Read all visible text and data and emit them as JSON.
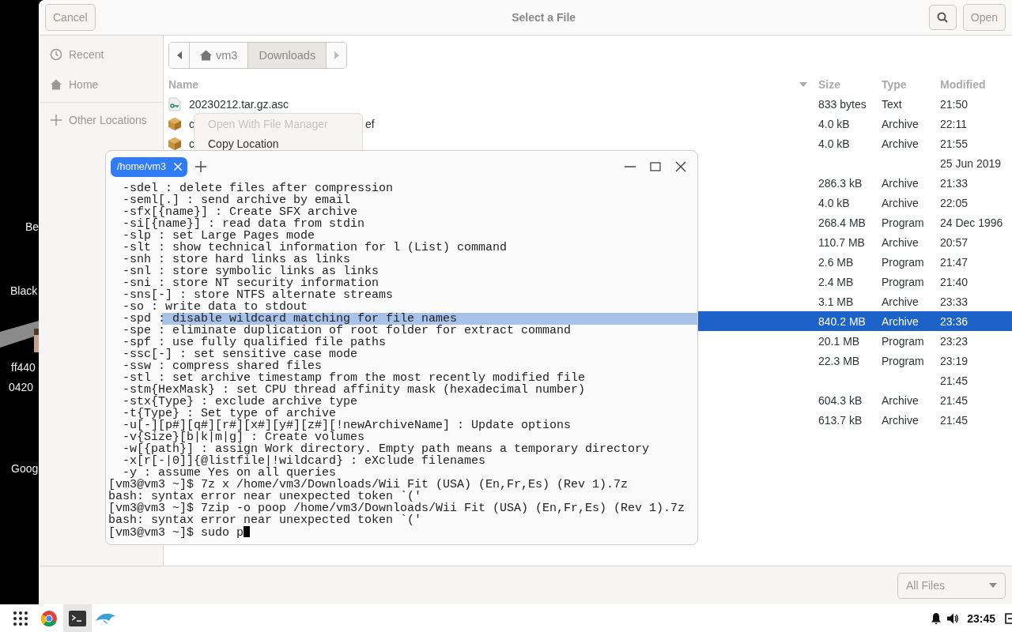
{
  "desktop": {
    "labels": [
      {
        "lines": [
          "Be"
        ]
      },
      {
        "lines": [
          "Black"
        ]
      },
      {
        "lines": [
          "ff440",
          "0420"
        ]
      },
      {
        "lines": [
          "Goog"
        ]
      }
    ]
  },
  "dialog": {
    "cancel": "Cancel",
    "title": "Select a File",
    "open": "Open",
    "sidebar": [
      {
        "kind": "recent",
        "label": "Recent"
      },
      {
        "kind": "home",
        "label": "Home"
      },
      {
        "kind": "other",
        "label": "Other Locations"
      }
    ],
    "path": [
      {
        "label": "vm3",
        "home": true,
        "selected": false
      },
      {
        "label": "Downloads",
        "home": false,
        "selected": true
      }
    ],
    "columns": [
      "Name",
      "Size",
      "Type",
      "Modified"
    ],
    "rows": [
      {
        "kind": "key",
        "name": "20230212.tar.gz.asc",
        "size": "833 bytes",
        "type": "Text",
        "modified": "21:50",
        "selected": false
      },
      {
        "kind": "archive",
        "name": "c",
        "tail": "ef",
        "size": "4.0 kB",
        "type": "Archive",
        "modified": "22:11",
        "selected": false
      },
      {
        "kind": "archive",
        "name": "c",
        "size": "4.0 kB",
        "type": "Archive",
        "modified": "21:55",
        "selected": false
      },
      {
        "modified": "25 Jun 2019",
        "selected": false
      },
      {
        "size": "286.3 kB",
        "type": "Archive",
        "modified": "21:33",
        "selected": false
      },
      {
        "size": "4.0 kB",
        "type": "Archive",
        "modified": "22:05",
        "selected": false
      },
      {
        "size": "268.4 MB",
        "type": "Program",
        "modified": "24 Dec 1996",
        "selected": false
      },
      {
        "size": "110.7 MB",
        "type": "Archive",
        "modified": "20:57",
        "selected": false
      },
      {
        "size": "2.6 MB",
        "type": "Program",
        "modified": "21:47",
        "selected": false
      },
      {
        "size": "2.4 MB",
        "type": "Program",
        "modified": "21:40",
        "selected": false
      },
      {
        "size": "3.1 MB",
        "type": "Archive",
        "modified": "23:33",
        "selected": false
      },
      {
        "size": "840.2 MB",
        "type": "Archive",
        "modified": "23:36",
        "selected": true
      },
      {
        "size": "20.1 MB",
        "type": "Program",
        "modified": "23:23",
        "selected": false
      },
      {
        "size": "22.3 MB",
        "type": "Program",
        "modified": "23:19",
        "selected": false
      },
      {
        "modified": "21:45",
        "selected": false
      },
      {
        "size": "604.3 kB",
        "type": "Archive",
        "modified": "21:45",
        "selected": false
      },
      {
        "size": "613.7 kB",
        "type": "Archive",
        "modified": "21:45",
        "selected": false
      }
    ],
    "filter": "All Files"
  },
  "context_menu": [
    {
      "label": "Open With File Manager",
      "disabled": true
    },
    {
      "label": "Copy Location",
      "disabled": false
    }
  ],
  "terminal": {
    "tab": "/home/vm3",
    "lines": [
      {
        "text": "  -sdel : delete files after compression",
        "highlighted": false
      },
      {
        "text": "  -seml[.] : send archive by email",
        "highlighted": false
      },
      {
        "text": "  -sfx[{name}] : Create SFX archive",
        "highlighted": false
      },
      {
        "text": "  -si[{name}] : read data from stdin",
        "highlighted": false
      },
      {
        "text": "  -slp : set Large Pages mode",
        "highlighted": false
      },
      {
        "text": "  -slt : show technical information for l (List) command",
        "highlighted": false
      },
      {
        "text": "  -snh : store hard links as links",
        "highlighted": false
      },
      {
        "text": "  -snl : store symbolic links as links",
        "highlighted": false
      },
      {
        "text": "  -sni : store NT security information",
        "highlighted": false
      },
      {
        "text": "  -sns[-] : store NTFS alternate streams",
        "highlighted": false
      },
      {
        "text": "  -so : write data to stdout",
        "highlighted": false
      },
      {
        "text": "  -spd : disable wildcard matching for file names",
        "highlighted": true
      },
      {
        "text": "  -spe : eliminate duplication of root folder for extract command",
        "highlighted": false
      },
      {
        "text": "  -spf : use fully qualified file paths",
        "highlighted": false
      },
      {
        "text": "  -ssc[-] : set sensitive case mode",
        "highlighted": false
      },
      {
        "text": "  -ssw : compress shared files",
        "highlighted": false
      },
      {
        "text": "  -stl : set archive timestamp from the most recently modified file",
        "highlighted": false
      },
      {
        "text": "  -stm{HexMask} : set CPU thread affinity mask (hexadecimal number)",
        "highlighted": false
      },
      {
        "text": "  -stx{Type} : exclude archive type",
        "highlighted": false
      },
      {
        "text": "  -t{Type} : Set type of archive",
        "highlighted": false
      },
      {
        "text": "  -u[-][p#][q#][r#][x#][y#][z#][!newArchiveName] : Update options",
        "highlighted": false
      },
      {
        "text": "  -v{Size}[b|k|m|g] : Create volumes",
        "highlighted": false
      },
      {
        "text": "  -w[{path}] : assign Work directory. Empty path means a temporary directory",
        "highlighted": false
      },
      {
        "text": "  -x[r[-|0]]{@listfile|!wildcard} : eXclude filenames",
        "highlighted": false
      },
      {
        "text": "  -y : assume Yes on all queries",
        "highlighted": false
      },
      {
        "text": "[vm3@vm3 ~]$ 7z x /home/vm3/Downloads/Wii Fit (USA) (En,Fr,Es) (Rev 1).7z",
        "highlighted": false
      },
      {
        "text": "bash: syntax error near unexpected token `('",
        "highlighted": false
      },
      {
        "text": "[vm3@vm3 ~]$ 7zip -o poop /home/vm3/Downloads/Wii Fit (USA) (En,Fr,Es) (Rev 1).7z",
        "highlighted": false
      },
      {
        "text": "bash: syntax error near unexpected token `('",
        "highlighted": false
      },
      {
        "text": "[vm3@vm3 ~]$ sudo p",
        "highlighted": false
      }
    ]
  },
  "taskbar": {
    "clock": "23:45"
  }
}
